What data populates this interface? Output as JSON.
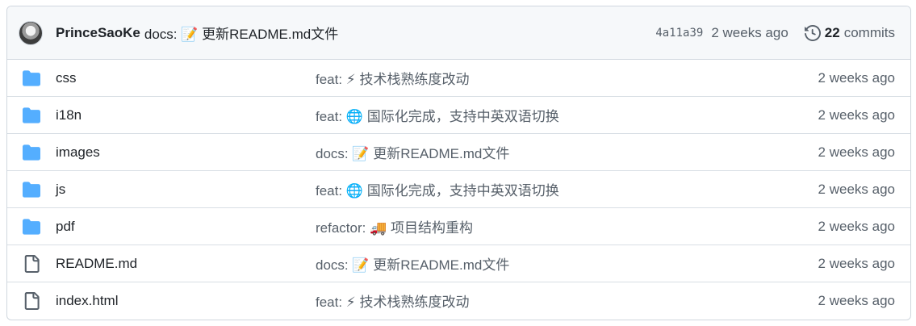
{
  "header": {
    "author": "PrinceSaoKe",
    "message": "docs: 📝 更新README.md文件",
    "sha": "4a11a39",
    "time": "2 weeks ago",
    "commit_count": "22",
    "commit_label": "commits"
  },
  "files": [
    {
      "type": "folder-icon",
      "name": "css",
      "message": "feat: ⚡ 技术栈熟练度改动",
      "time": "2 weeks ago"
    },
    {
      "type": "folder-icon",
      "name": "i18n",
      "message": "feat: 🌐 国际化完成，支持中英双语切换",
      "time": "2 weeks ago"
    },
    {
      "type": "folder-icon",
      "name": "images",
      "message": "docs: 📝 更新README.md文件",
      "time": "2 weeks ago"
    },
    {
      "type": "folder-icon",
      "name": "js",
      "message": "feat: 🌐 国际化完成，支持中英双语切换",
      "time": "2 weeks ago"
    },
    {
      "type": "folder-icon",
      "name": "pdf",
      "message": "refactor: 🚚 项目结构重构",
      "time": "2 weeks ago"
    },
    {
      "type": "file-icon",
      "name": "README.md",
      "message": "docs: 📝 更新README.md文件",
      "time": "2 weeks ago"
    },
    {
      "type": "file-icon",
      "name": "index.html",
      "message": "feat: ⚡ 技术栈熟练度改动",
      "time": "2 weeks ago"
    }
  ],
  "colors": {
    "folder": "#54aeff",
    "file": "#57606a",
    "border": "#d0d7de",
    "header_bg": "#f6f8fa",
    "muted_text": "#57606a"
  }
}
